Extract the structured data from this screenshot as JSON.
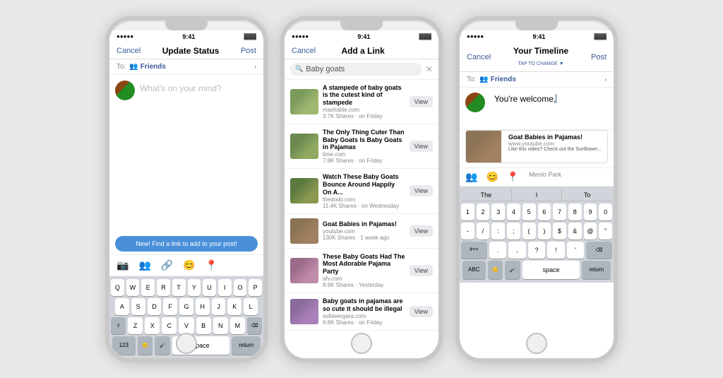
{
  "phone1": {
    "statusBar": {
      "signal": "●●●●●",
      "time": "9:41",
      "battery": "🔋"
    },
    "navBar": {
      "cancel": "Cancel",
      "title": "Update Status",
      "post": "Post"
    },
    "toRow": {
      "label": "To:",
      "friends": "Friends"
    },
    "placeholder": "What's on your mind?",
    "tooltip": "New! Find a link to add to your post!",
    "keyboard": {
      "row1": [
        "Q",
        "W",
        "E",
        "R",
        "T",
        "Y",
        "U",
        "I",
        "O",
        "P"
      ],
      "row2": [
        "A",
        "S",
        "D",
        "F",
        "G",
        "H",
        "J",
        "K",
        "L"
      ],
      "row3": [
        "Z",
        "X",
        "C",
        "V",
        "B",
        "N",
        "M"
      ],
      "bottom": [
        "123",
        "😊",
        "🎤",
        "space",
        "return"
      ]
    }
  },
  "phone2": {
    "statusBar": {
      "signal": "●●●●●",
      "time": "9:41",
      "battery": "🔋"
    },
    "navBar": {
      "cancel": "Cancel",
      "title": "Add a Link"
    },
    "search": {
      "placeholder": "Baby goats",
      "value": "Baby goats"
    },
    "links": [
      {
        "title": "A stampede of baby goats is the cutest kind of stampede",
        "domain": "mashable.com",
        "shares": "3.7K Shares · on Friday",
        "thumb": "thumb-goat1"
      },
      {
        "title": "The Only Thing Cuter Than Baby Goats Is Baby Goats in Pajamas",
        "domain": "time.com",
        "shares": "7.8K Shares · on Friday",
        "thumb": "thumb-goat2"
      },
      {
        "title": "Watch These Baby Goats Bounce Around Happily On A...",
        "domain": "thedodo.com",
        "shares": "11.4K Shares · on Wednesday",
        "thumb": "thumb-goat3"
      },
      {
        "title": "Goat Babies in Pajamas!",
        "domain": "youtube.com",
        "shares": "130K Shares · 1 week ago",
        "thumb": "thumb-goat4"
      },
      {
        "title": "These Baby Goats Had The Most Adorable Pajama Party",
        "domain": "afv.com",
        "shares": "8.9K Shares · Yesterday",
        "thumb": "thumb-goat5"
      },
      {
        "title": "Baby goats in pajamas are so cute it should be illegal",
        "domain": "sofiavergara.com",
        "shares": "6.8K Shares · on Friday",
        "thumb": "thumb-goat6"
      }
    ],
    "viewLabel": "View"
  },
  "phone3": {
    "statusBar": {
      "signal": "●●●●●",
      "time": "9:41",
      "battery": "🔋"
    },
    "navBar": {
      "cancel": "Cancel",
      "title": "Your Timeline",
      "subtitle": "TAP TO CHANGE ▼",
      "post": "Post"
    },
    "toRow": {
      "label": "To:",
      "friends": "Friends"
    },
    "typedText": "You're welcome,",
    "linkPreview": {
      "title": "Goat Babies in Pajamas!",
      "domain": "www.youtube.com",
      "description": "Like this video? Check out the Sunflower..."
    },
    "location": "Menlo Park",
    "keyboard": {
      "suggestions": [
        "The",
        "I",
        "To"
      ],
      "numRow": [
        "1",
        "2",
        "3",
        "4",
        "5",
        "6",
        "7",
        "8",
        "9",
        "0"
      ],
      "symRow1": [
        "-",
        "/",
        ":",
        ";",
        "(",
        ")",
        "$",
        "&",
        "@",
        "\""
      ],
      "symRow2": [
        "#+= ",
        ".",
        ",",
        "?",
        "!",
        "'"
      ],
      "bottom": [
        "ABC",
        "😊",
        "🎤",
        "space",
        "return"
      ]
    }
  }
}
